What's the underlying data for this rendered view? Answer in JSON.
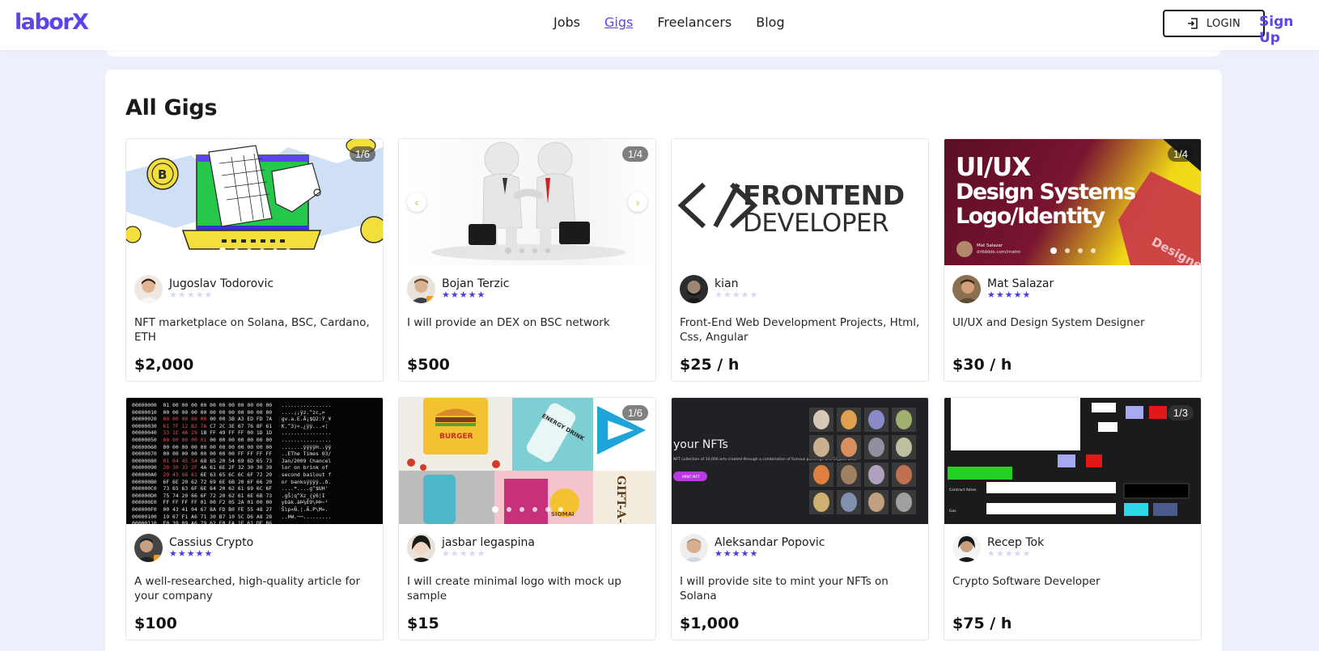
{
  "header": {
    "logo": "laborX",
    "nav": [
      {
        "label": "Jobs",
        "active": false
      },
      {
        "label": "Gigs",
        "active": true
      },
      {
        "label": "Freelancers",
        "active": false
      },
      {
        "label": "Blog",
        "active": false
      }
    ],
    "login_label": "LOGIN",
    "signup_label": "Sign Up"
  },
  "panel": {
    "title": "All Gigs"
  },
  "colors": {
    "accent": "#5a46e8",
    "star_active": "#4b3ddd",
    "star_inactive": "#d9d7f7"
  },
  "cards": [
    {
      "author": "Jugoslav Todorovic",
      "rating": 0,
      "description": "NFT marketplace on Solana, BSC, Cardano, ETH",
      "price": "$2,000",
      "image_count": "1/6",
      "image": "nft-laptop-illustration"
    },
    {
      "author": "Bojan Terzic",
      "rating": 5,
      "description": "I will provide an DEX on BSC network",
      "price": "$500",
      "image_count": "1/4",
      "image": "handshake-3d-figures"
    },
    {
      "author": "kian",
      "rating": 0,
      "description": "Front-End Web Development Projects, Html, Css, Angular",
      "price": "$25 / h",
      "image_count": "",
      "image": "frontend-developer-logo",
      "image_text": {
        "line1": "FRONTEND",
        "line2": "DEVELOPER"
      }
    },
    {
      "author": "Mat Salazar",
      "rating": 5,
      "description": "UI/UX and Design System Designer",
      "price": "$30 / h",
      "image_count": "1/4",
      "image": "uiux-design-banner",
      "image_text": {
        "line1": "UI/UX",
        "line2": "Design Systems",
        "line3": "Logo/Identity",
        "credit_name": "Mat Salazar",
        "credit_url": "dribbble.com/matm",
        "corner": "Designe"
      }
    },
    {
      "author": "Cassius Crypto",
      "rating": 5,
      "description": "A well-researched, high-quality article for your company",
      "price": "$100",
      "image_count": "",
      "image": "hex-dump-screen"
    },
    {
      "author": "jasbar legaspina",
      "rating": 0,
      "description": "I will create minimal logo with mock up sample",
      "price": "$15",
      "image_count": "1/6",
      "image": "logo-mockups",
      "image_text": {
        "burger": "BURGER",
        "energy": "ENERGY DRINK",
        "gift": "GIFT-A-B",
        "siomai": "SIOMAI"
      }
    },
    {
      "author": "Aleksandar Popovic",
      "rating": 5,
      "description": "I will provide site to mint your NFTs on Solana",
      "price": "$1,000",
      "image_count": "",
      "image": "nft-mint-site",
      "image_text": {
        "heading": "your NFTs",
        "body": "NFT collection of 10,000 arts created through a combination of famous paintings and CryptoPunks.",
        "button": "MINT NFT"
      }
    },
    {
      "author": "Recep Tok",
      "rating": 0,
      "description": "Crypto Software Developer",
      "price": "$75 / h",
      "image_count": "1/3",
      "image": "crypto-software-ui",
      "image_text": {
        "contract": "Contract Adres",
        "gas": "Gas"
      }
    }
  ]
}
